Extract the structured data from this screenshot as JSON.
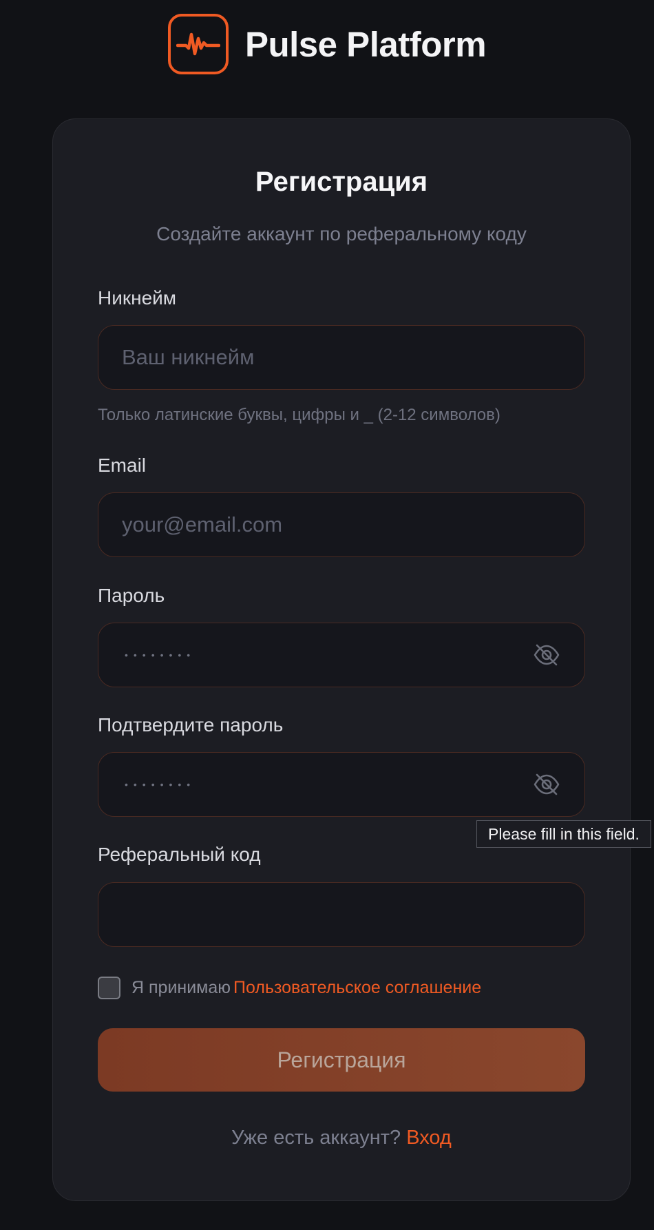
{
  "brand": {
    "name": "Pulse Platform",
    "icon": "pulse-wave-icon",
    "accent": "#f05a23"
  },
  "form": {
    "title": "Регистрация",
    "subtitle": "Создайте аккаунт по реферальному коду",
    "nickname": {
      "label": "Никнейм",
      "placeholder": "Ваш никнейм",
      "hint": "Только латинские буквы, цифры и _ (2-12 символов)"
    },
    "email": {
      "label": "Email",
      "placeholder": "your@email.com"
    },
    "password": {
      "label": "Пароль",
      "masked": "••••••••",
      "toggle_icon": "eye-off-icon"
    },
    "confirm_password": {
      "label": "Подтвердите пароль",
      "masked": "••••••••",
      "toggle_icon": "eye-off-icon"
    },
    "referral": {
      "label": "Реферальный код",
      "value": ""
    },
    "agreement": {
      "text": "Я принимаю",
      "link": "Пользовательское соглашение",
      "checked": false
    },
    "submit_label": "Регистрация",
    "signin": {
      "question": "Уже есть аккаунт?",
      "link": "Вход"
    }
  },
  "tooltip": {
    "text": "Please fill in this field."
  }
}
